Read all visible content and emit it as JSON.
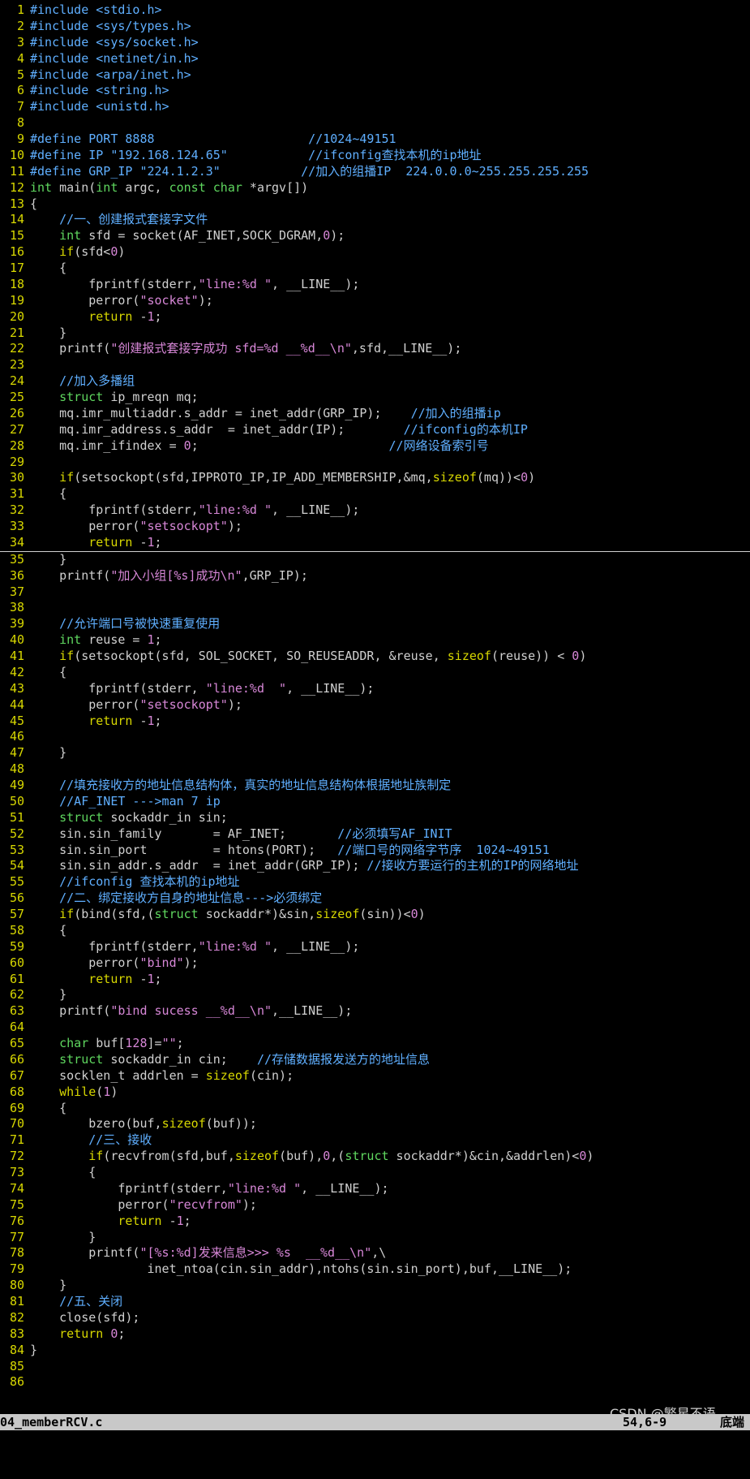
{
  "editor": {
    "filename": "04_memberRCV.c",
    "cursor_position": "54,6-9",
    "scroll_position": "底端",
    "cursor_line": 34,
    "lines": [
      [
        [
          "pp",
          "#include <stdio.h>"
        ]
      ],
      [
        [
          "pp",
          "#include <sys/types.h>"
        ]
      ],
      [
        [
          "pp",
          "#include <sys/socket.h>"
        ]
      ],
      [
        [
          "pp",
          "#include <netinet/in.h>"
        ]
      ],
      [
        [
          "pp",
          "#include <arpa/inet.h>"
        ]
      ],
      [
        [
          "pp",
          "#include <string.h>"
        ]
      ],
      [
        [
          "pp",
          "#include <unistd.h>"
        ]
      ],
      [],
      [
        [
          "pp",
          "#define PORT 8888                     //1024~49151"
        ]
      ],
      [
        [
          "pp",
          "#define IP \"192.168.124.65\"           //ifconfig查找本机的ip地址"
        ]
      ],
      [
        [
          "pp",
          "#define GRP_IP \"224.1.2.3\"           //加入的组播IP  224.0.0.0~255.255.255.255"
        ]
      ],
      [
        [
          "t",
          "int"
        ],
        [
          "plain",
          " main("
        ],
        [
          "t",
          "int"
        ],
        [
          "plain",
          " argc, "
        ],
        [
          "t",
          "const char"
        ],
        [
          "plain",
          " *argv[])"
        ]
      ],
      [
        [
          "plain",
          "{"
        ]
      ],
      [
        [
          "plain",
          "    "
        ],
        [
          "c",
          "//一、创建报式套接字文件"
        ]
      ],
      [
        [
          "plain",
          "    "
        ],
        [
          "t",
          "int"
        ],
        [
          "plain",
          " sfd = socket(AF_INET,SOCK_DGRAM,"
        ],
        [
          "n",
          "0"
        ],
        [
          "plain",
          ");"
        ]
      ],
      [
        [
          "plain",
          "    "
        ],
        [
          "k",
          "if"
        ],
        [
          "plain",
          "(sfd<"
        ],
        [
          "n",
          "0"
        ],
        [
          "plain",
          ")"
        ]
      ],
      [
        [
          "plain",
          "    {"
        ]
      ],
      [
        [
          "plain",
          "        fprintf(stderr,"
        ],
        [
          "s",
          "\"line:%d \""
        ],
        [
          "plain",
          ", __LINE__);"
        ]
      ],
      [
        [
          "plain",
          "        perror("
        ],
        [
          "s",
          "\"socket\""
        ],
        [
          "plain",
          ");"
        ]
      ],
      [
        [
          "plain",
          "        "
        ],
        [
          "k",
          "return"
        ],
        [
          "plain",
          " -"
        ],
        [
          "n",
          "1"
        ],
        [
          "plain",
          ";"
        ]
      ],
      [
        [
          "plain",
          "    }"
        ]
      ],
      [
        [
          "plain",
          "    printf("
        ],
        [
          "s",
          "\"创建报式套接字成功 sfd=%d __%d__\\n\""
        ],
        [
          "plain",
          ",sfd,__LINE__);"
        ]
      ],
      [],
      [
        [
          "plain",
          "    "
        ],
        [
          "c",
          "//加入多播组"
        ]
      ],
      [
        [
          "plain",
          "    "
        ],
        [
          "t",
          "struct"
        ],
        [
          "plain",
          " ip_mreqn mq;"
        ]
      ],
      [
        [
          "plain",
          "    mq.imr_multiaddr.s_addr = inet_addr(GRP_IP);    "
        ],
        [
          "c",
          "//加入的组播ip"
        ]
      ],
      [
        [
          "plain",
          "    mq.imr_address.s_addr  = inet_addr(IP);        "
        ],
        [
          "c",
          "//ifconfig的本机IP"
        ]
      ],
      [
        [
          "plain",
          "    mq.imr_ifindex = "
        ],
        [
          "n",
          "0"
        ],
        [
          "plain",
          ";                          "
        ],
        [
          "c",
          "//网络设备索引号"
        ]
      ],
      [],
      [
        [
          "plain",
          "    "
        ],
        [
          "k",
          "if"
        ],
        [
          "plain",
          "(setsockopt(sfd,IPPROTO_IP,IP_ADD_MEMBERSHIP,&mq,"
        ],
        [
          "k",
          "sizeof"
        ],
        [
          "plain",
          "(mq))<"
        ],
        [
          "n",
          "0"
        ],
        [
          "plain",
          ")"
        ]
      ],
      [
        [
          "plain",
          "    {"
        ]
      ],
      [
        [
          "plain",
          "        fprintf(stderr,"
        ],
        [
          "s",
          "\"line:%d \""
        ],
        [
          "plain",
          ", __LINE__);"
        ]
      ],
      [
        [
          "plain",
          "        perror("
        ],
        [
          "s",
          "\"setsockopt\""
        ],
        [
          "plain",
          ");"
        ]
      ],
      [
        [
          "plain",
          "        "
        ],
        [
          "k",
          "return"
        ],
        [
          "plain",
          " -"
        ],
        [
          "n",
          "1"
        ],
        [
          "plain",
          ";"
        ]
      ],
      [
        [
          "plain",
          "    }"
        ]
      ],
      [
        [
          "plain",
          "    printf("
        ],
        [
          "s",
          "\"加入小组[%s]成功\\n\""
        ],
        [
          "plain",
          ",GRP_IP);"
        ]
      ],
      [],
      [],
      [
        [
          "plain",
          "    "
        ],
        [
          "c",
          "//允许端口号被快速重复使用"
        ]
      ],
      [
        [
          "plain",
          "    "
        ],
        [
          "t",
          "int"
        ],
        [
          "plain",
          " reuse = "
        ],
        [
          "n",
          "1"
        ],
        [
          "plain",
          ";"
        ]
      ],
      [
        [
          "plain",
          "    "
        ],
        [
          "k",
          "if"
        ],
        [
          "plain",
          "(setsockopt(sfd, SOL_SOCKET, SO_REUSEADDR, &reuse, "
        ],
        [
          "k",
          "sizeof"
        ],
        [
          "plain",
          "(reuse)) < "
        ],
        [
          "n",
          "0"
        ],
        [
          "plain",
          ")"
        ]
      ],
      [
        [
          "plain",
          "    {"
        ]
      ],
      [
        [
          "plain",
          "        fprintf(stderr, "
        ],
        [
          "s",
          "\"line:%d  \""
        ],
        [
          "plain",
          ", __LINE__);"
        ]
      ],
      [
        [
          "plain",
          "        perror("
        ],
        [
          "s",
          "\"setsockopt\""
        ],
        [
          "plain",
          ");"
        ]
      ],
      [
        [
          "plain",
          "        "
        ],
        [
          "k",
          "return"
        ],
        [
          "plain",
          " -"
        ],
        [
          "n",
          "1"
        ],
        [
          "plain",
          ";"
        ]
      ],
      [],
      [
        [
          "plain",
          "    }"
        ]
      ],
      [],
      [
        [
          "plain",
          "    "
        ],
        [
          "c",
          "//填充接收方的地址信息结构体，真实的地址信息结构体根据地址族制定"
        ]
      ],
      [
        [
          "plain",
          "    "
        ],
        [
          "c",
          "//AF_INET --->man 7 ip"
        ]
      ],
      [
        [
          "plain",
          "    "
        ],
        [
          "t",
          "struct"
        ],
        [
          "plain",
          " sockaddr_in sin;"
        ]
      ],
      [
        [
          "plain",
          "    sin.sin_family       = AF_INET;       "
        ],
        [
          "c",
          "//必须填写AF_INIT"
        ]
      ],
      [
        [
          "plain",
          "    sin.sin_port         = htons(PORT);   "
        ],
        [
          "c",
          "//端口号的网络字节序  1024~49151"
        ]
      ],
      [
        [
          "plain",
          "    sin.sin_addr.s_addr  = inet_addr(GRP_IP); "
        ],
        [
          "c",
          "//接收方要运行的主机的IP的网络地址"
        ]
      ],
      [
        [
          "plain",
          "    "
        ],
        [
          "c",
          "//ifconfig 查找本机的ip地址"
        ]
      ],
      [
        [
          "plain",
          "    "
        ],
        [
          "c",
          "//二、绑定接收方自身的地址信息--->必须绑定"
        ]
      ],
      [
        [
          "plain",
          "    "
        ],
        [
          "k",
          "if"
        ],
        [
          "plain",
          "(bind(sfd,("
        ],
        [
          "t",
          "struct"
        ],
        [
          "plain",
          " sockaddr*)&sin,"
        ],
        [
          "k",
          "sizeof"
        ],
        [
          "plain",
          "(sin))<"
        ],
        [
          "n",
          "0"
        ],
        [
          "plain",
          ")"
        ]
      ],
      [
        [
          "plain",
          "    {"
        ]
      ],
      [
        [
          "plain",
          "        fprintf(stderr,"
        ],
        [
          "s",
          "\"line:%d \""
        ],
        [
          "plain",
          ", __LINE__);"
        ]
      ],
      [
        [
          "plain",
          "        perror("
        ],
        [
          "s",
          "\"bind\""
        ],
        [
          "plain",
          ");"
        ]
      ],
      [
        [
          "plain",
          "        "
        ],
        [
          "k",
          "return"
        ],
        [
          "plain",
          " -"
        ],
        [
          "n",
          "1"
        ],
        [
          "plain",
          ";"
        ]
      ],
      [
        [
          "plain",
          "    }"
        ]
      ],
      [
        [
          "plain",
          "    printf("
        ],
        [
          "s",
          "\"bind sucess __%d__\\n\""
        ],
        [
          "plain",
          ",__LINE__);"
        ]
      ],
      [],
      [
        [
          "plain",
          "    "
        ],
        [
          "t",
          "char"
        ],
        [
          "plain",
          " buf["
        ],
        [
          "n",
          "128"
        ],
        [
          "plain",
          "]="
        ],
        [
          "s",
          "\"\""
        ],
        [
          "plain",
          ";"
        ]
      ],
      [
        [
          "plain",
          "    "
        ],
        [
          "t",
          "struct"
        ],
        [
          "plain",
          " sockaddr_in cin;    "
        ],
        [
          "c",
          "//存储数据报发送方的地址信息"
        ]
      ],
      [
        [
          "plain",
          "    socklen_t addrlen = "
        ],
        [
          "k",
          "sizeof"
        ],
        [
          "plain",
          "(cin);"
        ]
      ],
      [
        [
          "plain",
          "    "
        ],
        [
          "k",
          "while"
        ],
        [
          "plain",
          "("
        ],
        [
          "n",
          "1"
        ],
        [
          "plain",
          ")"
        ]
      ],
      [
        [
          "plain",
          "    {"
        ]
      ],
      [
        [
          "plain",
          "        bzero(buf,"
        ],
        [
          "k",
          "sizeof"
        ],
        [
          "plain",
          "(buf));"
        ]
      ],
      [
        [
          "plain",
          "        "
        ],
        [
          "c",
          "//三、接收"
        ]
      ],
      [
        [
          "plain",
          "        "
        ],
        [
          "k",
          "if"
        ],
        [
          "plain",
          "(recvfrom(sfd,buf,"
        ],
        [
          "k",
          "sizeof"
        ],
        [
          "plain",
          "(buf),"
        ],
        [
          "n",
          "0"
        ],
        [
          "plain",
          ",("
        ],
        [
          "t",
          "struct"
        ],
        [
          "plain",
          " sockaddr*)&cin,&addrlen)<"
        ],
        [
          "n",
          "0"
        ],
        [
          "plain",
          ")"
        ]
      ],
      [
        [
          "plain",
          "        {"
        ]
      ],
      [
        [
          "plain",
          "            fprintf(stderr,"
        ],
        [
          "s",
          "\"line:%d \""
        ],
        [
          "plain",
          ", __LINE__);"
        ]
      ],
      [
        [
          "plain",
          "            perror("
        ],
        [
          "s",
          "\"recvfrom\""
        ],
        [
          "plain",
          ");"
        ]
      ],
      [
        [
          "plain",
          "            "
        ],
        [
          "k",
          "return"
        ],
        [
          "plain",
          " -"
        ],
        [
          "n",
          "1"
        ],
        [
          "plain",
          ";"
        ]
      ],
      [
        [
          "plain",
          "        }"
        ]
      ],
      [
        [
          "plain",
          "        printf("
        ],
        [
          "s",
          "\"[%s:%d]发来信息>>> %s  __%d__\\n\""
        ],
        [
          "plain",
          ",\\"
        ]
      ],
      [
        [
          "plain",
          "                inet_ntoa(cin.sin_addr),ntohs(sin.sin_port),buf,__LINE__);"
        ]
      ],
      [
        [
          "plain",
          "    }"
        ]
      ],
      [
        [
          "plain",
          "    "
        ],
        [
          "c",
          "//五、关闭"
        ]
      ],
      [
        [
          "plain",
          "    close(sfd);"
        ]
      ],
      [
        [
          "plain",
          "    "
        ],
        [
          "k",
          "return"
        ],
        [
          "plain",
          " "
        ],
        [
          "n",
          "0"
        ],
        [
          "plain",
          ";"
        ]
      ],
      [
        [
          "plain",
          "}"
        ]
      ],
      [],
      []
    ]
  },
  "watermark": "CSDN @繁星不语",
  "colors": {
    "background": "#000000",
    "line_number": "#d7d700",
    "preprocessor": "#5fafff",
    "comment": "#5fafff",
    "string": "#d787d7",
    "keyword": "#d7d700",
    "type": "#5fd75f",
    "statusbar": "#c8c8c8"
  }
}
